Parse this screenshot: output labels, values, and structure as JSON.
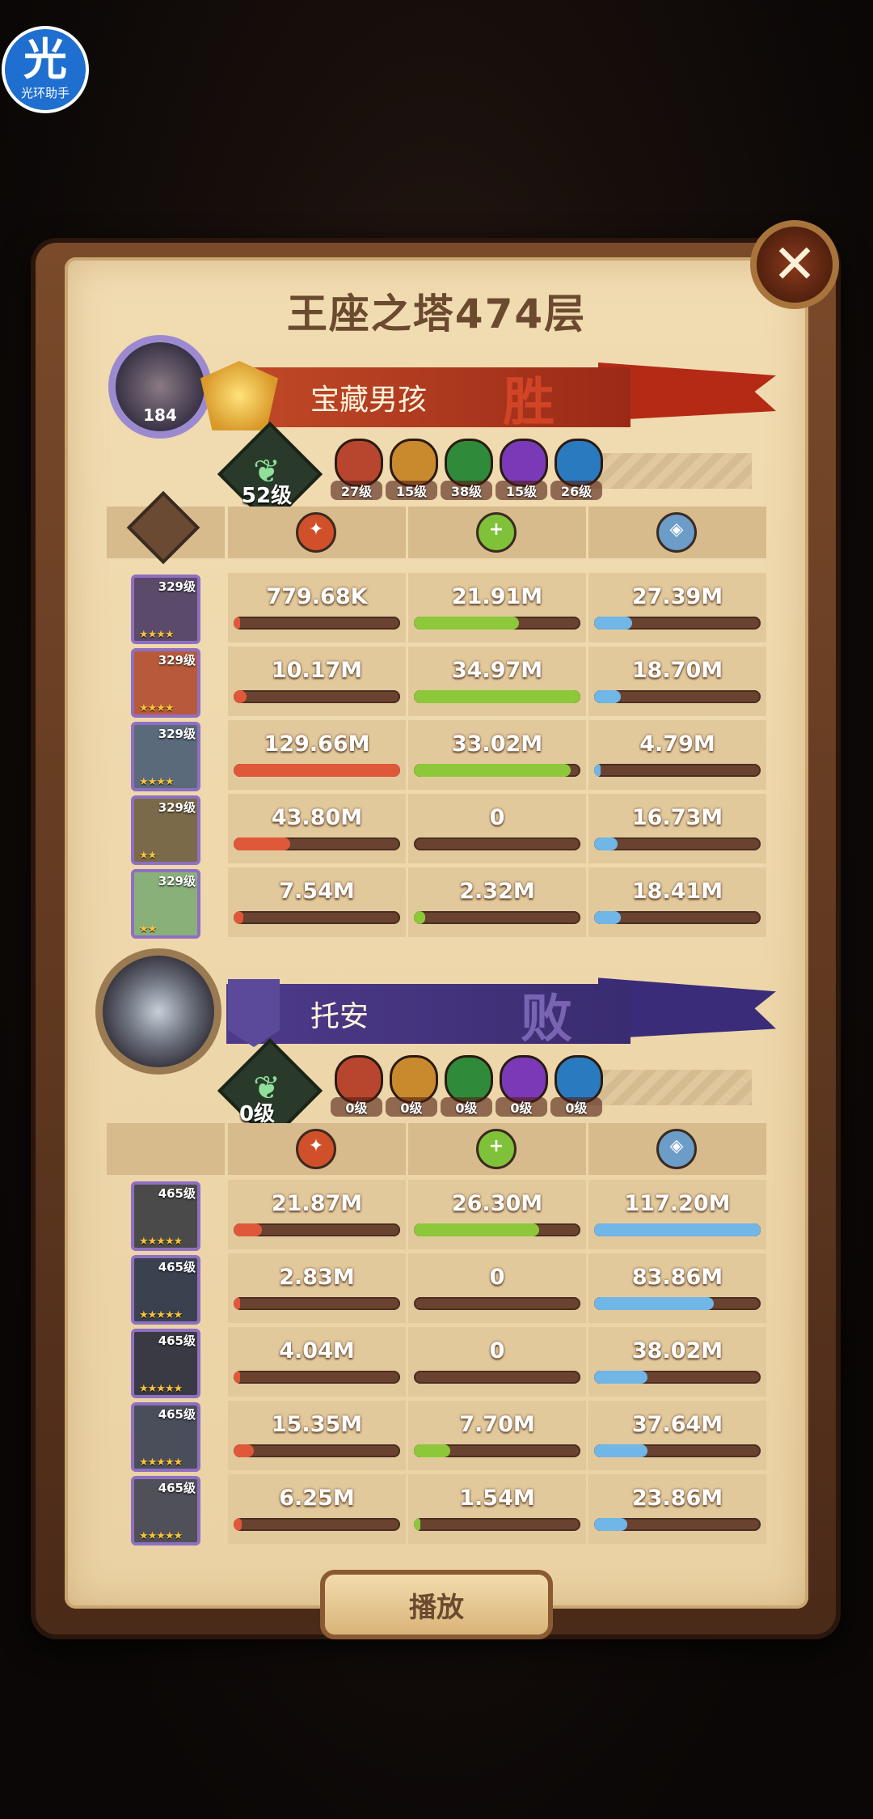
{
  "watermark": {
    "char": "光",
    "text": "光环助手"
  },
  "title": "王座之塔474层",
  "player1": {
    "avatar_level": "184",
    "name": "宝藏男孩",
    "result": "胜",
    "tree_level": "52级",
    "faction_levels": [
      "27级",
      "15级",
      "38级",
      "15级",
      "26级"
    ],
    "rows": [
      {
        "hero_level": "329级",
        "stars": "★★★★",
        "dmg": "779.68K",
        "heal": "21.91M",
        "tank": "27.39M",
        "dmg_frac": 0.01,
        "heal_frac": 0.63,
        "tank_frac": 0.23
      },
      {
        "hero_level": "329级",
        "stars": "★★★★",
        "dmg": "10.17M",
        "heal": "34.97M",
        "tank": "18.70M",
        "dmg_frac": 0.08,
        "heal_frac": 1.0,
        "tank_frac": 0.16
      },
      {
        "hero_level": "329级",
        "stars": "★★★★",
        "dmg": "129.66M",
        "heal": "33.02M",
        "tank": "4.79M",
        "dmg_frac": 1.0,
        "heal_frac": 0.94,
        "tank_frac": 0.04
      },
      {
        "hero_level": "329级",
        "stars": "★★",
        "dmg": "43.80M",
        "heal": "0",
        "tank": "16.73M",
        "dmg_frac": 0.34,
        "heal_frac": 0.0,
        "tank_frac": 0.14
      },
      {
        "hero_level": "329级",
        "stars": "★★",
        "dmg": "7.54M",
        "heal": "2.32M",
        "tank": "18.41M",
        "dmg_frac": 0.06,
        "heal_frac": 0.07,
        "tank_frac": 0.16
      }
    ]
  },
  "player2": {
    "name": "托安",
    "result": "败",
    "tree_level": "0级",
    "faction_levels": [
      "0级",
      "0级",
      "0级",
      "0级",
      "0级"
    ],
    "rows": [
      {
        "hero_level": "465级",
        "stars": "★★★★★",
        "dmg": "21.87M",
        "heal": "26.30M",
        "tank": "117.20M",
        "dmg_frac": 0.17,
        "heal_frac": 0.75,
        "tank_frac": 1.0
      },
      {
        "hero_level": "465级",
        "stars": "★★★★★",
        "dmg": "2.83M",
        "heal": "0",
        "tank": "83.86M",
        "dmg_frac": 0.02,
        "heal_frac": 0.0,
        "tank_frac": 0.72
      },
      {
        "hero_level": "465级",
        "stars": "★★★★★",
        "dmg": "4.04M",
        "heal": "0",
        "tank": "38.02M",
        "dmg_frac": 0.03,
        "heal_frac": 0.0,
        "tank_frac": 0.32
      },
      {
        "hero_level": "465级",
        "stars": "★★★★★",
        "dmg": "15.35M",
        "heal": "7.70M",
        "tank": "37.64M",
        "dmg_frac": 0.12,
        "heal_frac": 0.22,
        "tank_frac": 0.32
      },
      {
        "hero_level": "465级",
        "stars": "★★★★★",
        "dmg": "6.25M",
        "heal": "1.54M",
        "tank": "23.86M",
        "dmg_frac": 0.05,
        "heal_frac": 0.04,
        "tank_frac": 0.2
      }
    ]
  },
  "faction_colors": [
    "#b8462e",
    "#c88a2c",
    "#2f8a3a",
    "#7a3ab8",
    "#2a7ac0"
  ],
  "play_label": "播放",
  "close_icon": "close-icon"
}
